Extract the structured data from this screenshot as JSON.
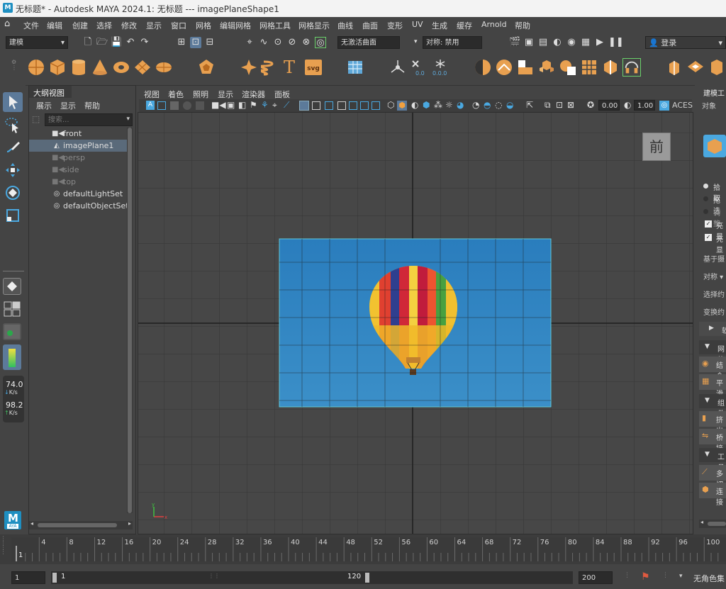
{
  "window": {
    "title": "无标题* - Autodesk MAYA 2024.1: 无标题   ---   imagePlaneShape1",
    "logo_text": "M"
  },
  "menubar": {
    "items": [
      "文件",
      "编辑",
      "创建",
      "选择",
      "修改",
      "显示",
      "窗口",
      "网格",
      "编辑网格",
      "网格工具",
      "网格显示",
      "曲线",
      "曲面",
      "变形",
      "UV",
      "生成",
      "缓存",
      "Arnold",
      "帮助"
    ]
  },
  "statusline": {
    "mode": "建模",
    "live_surface": "无激活曲面",
    "symmetry": "对称: 禁用",
    "login": "登录"
  },
  "shelf": {
    "text_icon": "T",
    "svg_icon": "svg"
  },
  "hud": {
    "net_down": "74.0",
    "net_down_unit": "K/s",
    "net_up": "98.2",
    "net_up_unit": "K/s",
    "maya_badge": "M",
    "maya_sub": "AYA"
  },
  "outliner": {
    "tab": "大纲视图",
    "menu": [
      "展示",
      "显示",
      "帮助"
    ],
    "search_placeholder": "搜索...",
    "items": [
      {
        "label": "front",
        "dim": false,
        "selected": false
      },
      {
        "label": "imagePlane1",
        "dim": false,
        "selected": true
      },
      {
        "label": "persp",
        "dim": true,
        "selected": false
      },
      {
        "label": "side",
        "dim": true,
        "selected": false
      },
      {
        "label": "top",
        "dim": true,
        "selected": false
      },
      {
        "label": "defaultLightSet",
        "dim": false,
        "selected": false
      },
      {
        "label": "defaultObjectSet",
        "dim": false,
        "selected": false
      }
    ]
  },
  "viewport": {
    "menu": [
      "视图",
      "着色",
      "照明",
      "显示",
      "渲染器",
      "面板"
    ],
    "exposure": "0.00",
    "gamma": "1.00",
    "colorspace": "ACES",
    "view_cube_label": "前",
    "axis_x": "x",
    "axis_y": "y"
  },
  "rightpanel": {
    "title": "建模工",
    "subtitle": "对象",
    "options": [
      "拾取",
      "拖选",
      "调整"
    ],
    "checks": [
      "亮显",
      "亮显"
    ],
    "labels": [
      "基于摄",
      "对称",
      "选择约",
      "变换约"
    ],
    "sections": [
      "软",
      "网格",
      "组件",
      "工具"
    ],
    "buttons": [
      "结合",
      "平滑",
      "挤出",
      "桥接",
      "多切",
      "连接"
    ]
  },
  "timeslider": {
    "ticks": [
      "4",
      "8",
      "12",
      "16",
      "20",
      "24",
      "28",
      "32",
      "36",
      "40",
      "44",
      "48",
      "52",
      "56",
      "60",
      "64",
      "68",
      "72",
      "76",
      "80",
      "84",
      "88",
      "92",
      "96",
      "100"
    ],
    "current_frame": "1"
  },
  "rangeslider": {
    "start": "1",
    "range_start": "1",
    "range_end": "120",
    "end": "200",
    "anim_layer": "无角色集"
  },
  "colors": {
    "accent": "#1f8fc1",
    "shelf_orange": "#e8a050",
    "selection": "#5a6a7a",
    "image_plane_border": "#5fc7d7"
  }
}
